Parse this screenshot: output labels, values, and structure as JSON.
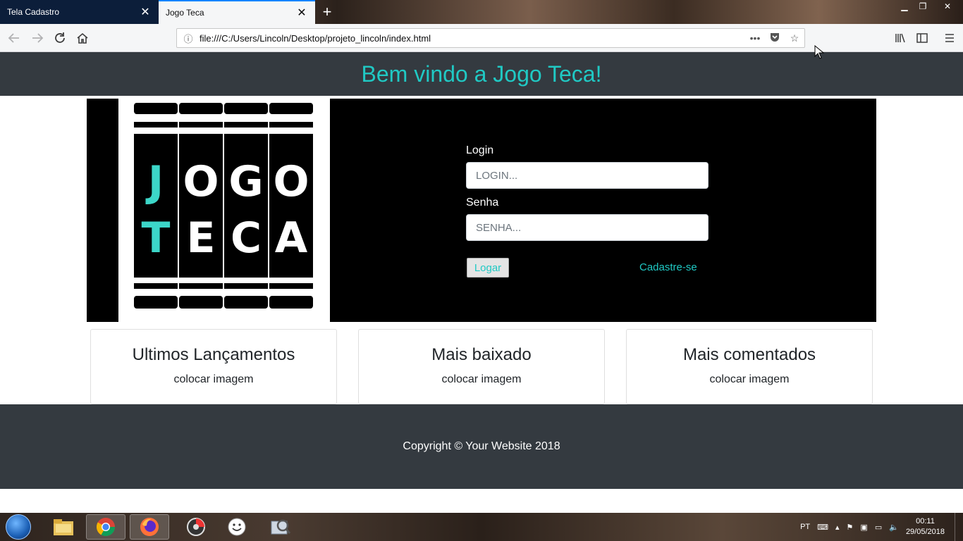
{
  "browser": {
    "tabs": [
      {
        "label": "Tela Cadastro",
        "active": false
      },
      {
        "label": "Jogo Teca",
        "active": true
      }
    ],
    "url": "file:///C:/Users/Lincoln/Desktop/projeto_lincoln/index.html",
    "accent": "#0a84ff"
  },
  "site": {
    "title": "Bem vindo a Jogo Teca!",
    "accent": "#20c9c4",
    "logo_letters": {
      "row1": [
        "J",
        "O",
        "G",
        "O"
      ],
      "row2": [
        "T",
        "E",
        "C",
        "A"
      ]
    }
  },
  "login": {
    "login_label": "Login",
    "login_placeholder": "LOGIN...",
    "password_label": "Senha",
    "password_placeholder": "SENHA...",
    "submit_label": "Logar",
    "register_link": "Cadastre-se"
  },
  "cards": [
    {
      "title": "Ultimos Lançamentos",
      "text": "colocar imagem"
    },
    {
      "title": "Mais baixado",
      "text": "colocar imagem"
    },
    {
      "title": "Mais comentados",
      "text": "colocar imagem"
    }
  ],
  "footer": {
    "text": "Copyright © Your Website 2018"
  },
  "taskbar": {
    "language": "PT",
    "time": "00:11",
    "date": "29/05/2018",
    "apps": [
      "windows-explorer",
      "chrome",
      "firefox",
      "media-player",
      "smiley-app",
      "image-viewer"
    ]
  }
}
